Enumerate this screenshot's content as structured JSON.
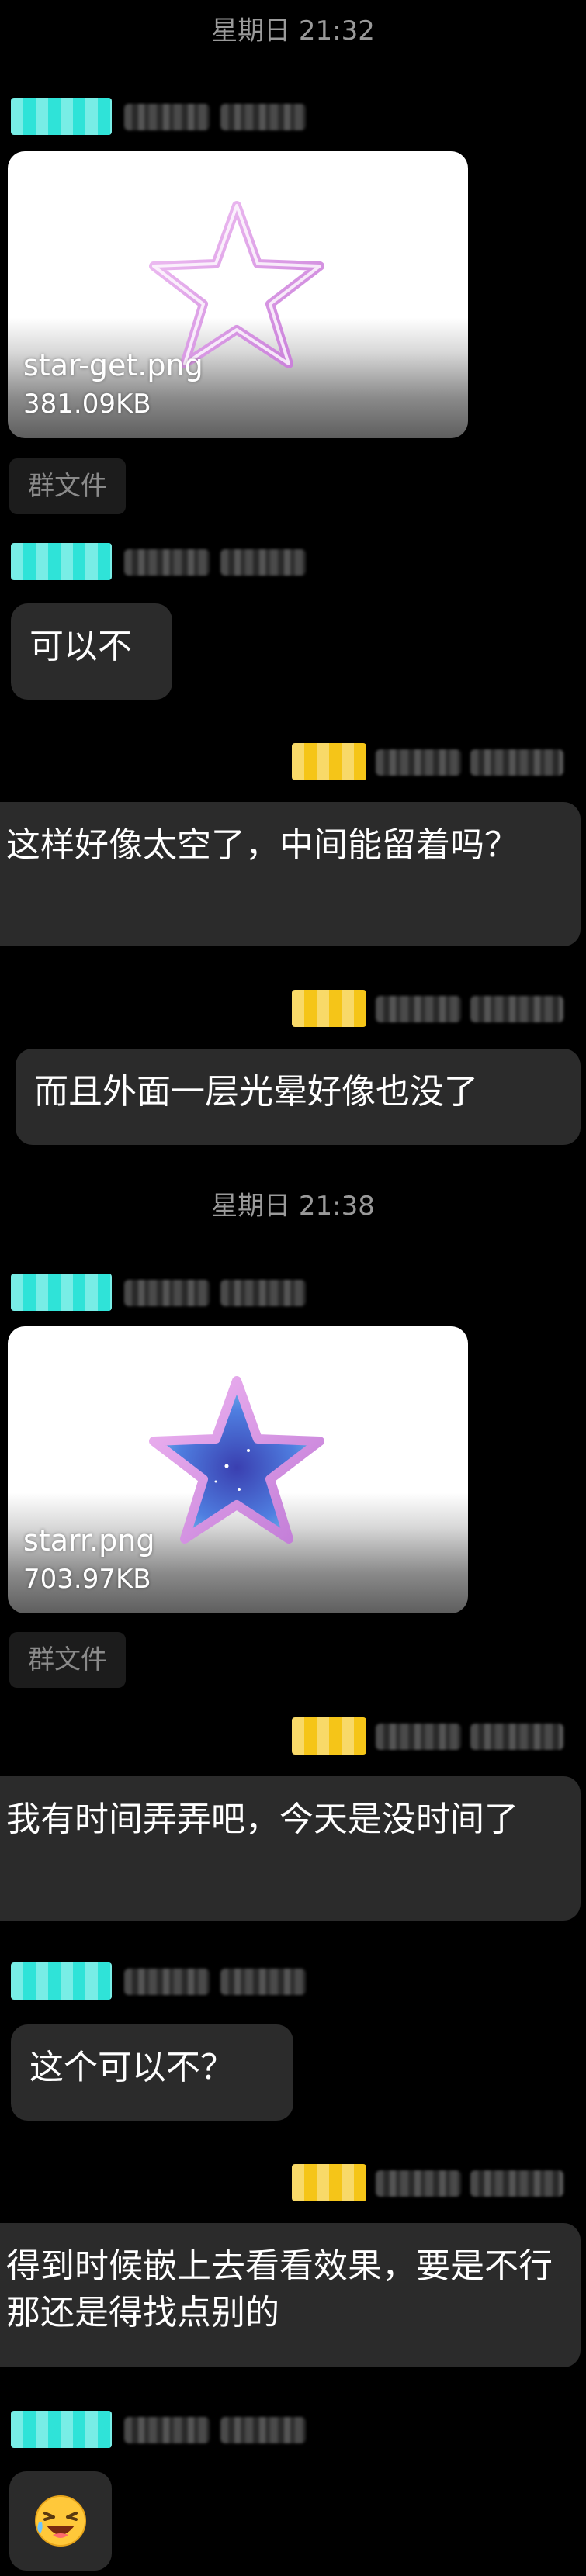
{
  "timestamps": {
    "first": "星期日 21:32",
    "second": "星期日 21:38"
  },
  "files": [
    {
      "name": "star-get.png",
      "size": "381.09KB"
    },
    {
      "name": "starr.png",
      "size": "703.97KB"
    }
  ],
  "group_file_label": "群文件",
  "messages": {
    "m1": "可以不",
    "m2": "这样好像太空了，中间能留着吗？",
    "m3": "而且外面一层光晕好像也没了",
    "m4": "我有时间弄弄吧，今天是没时间了",
    "m5": "这个可以不？",
    "m6": "得到时候嵌上去看看效果，要是不行那还是得找点别的"
  },
  "colors": {
    "background": "#000000",
    "bubble": "#2b2b2b",
    "tag_teal": "#2fe3d8",
    "tag_yellow": "#f5c518",
    "timestamp": "#9a9a9a"
  },
  "icons": [
    "star-outline-icon",
    "star-filled-icon",
    "laughing-emoji-icon"
  ]
}
